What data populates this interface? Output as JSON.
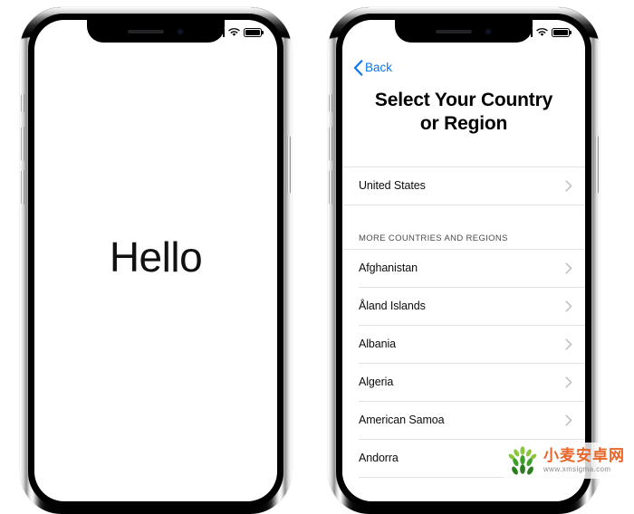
{
  "theme": {
    "ios_blue": "#0b76ef",
    "text_primary": "#0c0c0c",
    "separator": "#e2e2e4",
    "section_header_color": "#4c4c4e",
    "screen_background": "#ffffff",
    "bezel": "#000000",
    "watermark_orange": "#e8662a"
  },
  "phones": {
    "left": {
      "device_name": "iphone-left",
      "status_bar": {
        "signal_icon": "cellular-signal-icon",
        "wifi_icon": "wifi-icon",
        "battery_icon": "battery-icon"
      },
      "screen": {
        "greeting": "Hello"
      }
    },
    "right": {
      "device_name": "iphone-right",
      "status_bar": {
        "signal_icon": "cellular-signal-icon",
        "wifi_icon": "wifi-icon",
        "battery_icon": "battery-icon"
      },
      "screen": {
        "back_button": {
          "label": "Back",
          "icon": "chevron-left-icon"
        },
        "title": "Select Your Country or Region",
        "title_line_1": "Select Your Country",
        "title_line_2": "or Region",
        "selected_section": {
          "rows": [
            {
              "label": "United States",
              "accessory": "chevron-right-icon"
            }
          ]
        },
        "more_section": {
          "header": "MORE COUNTRIES AND REGIONS",
          "rows": [
            {
              "label": "Afghanistan",
              "accessory": "chevron-right-icon"
            },
            {
              "label": "Åland Islands",
              "accessory": "chevron-right-icon"
            },
            {
              "label": "Albania",
              "accessory": "chevron-right-icon"
            },
            {
              "label": "Algeria",
              "accessory": "chevron-right-icon"
            },
            {
              "label": "American Samoa",
              "accessory": "chevron-right-icon"
            },
            {
              "label": "Andorra",
              "accessory": "chevron-right-icon"
            }
          ]
        }
      }
    }
  },
  "watermark": {
    "logo_icon": "wheat-logo-icon",
    "site_name": "小麦安卓网",
    "url": "www.xmsigma.com"
  }
}
